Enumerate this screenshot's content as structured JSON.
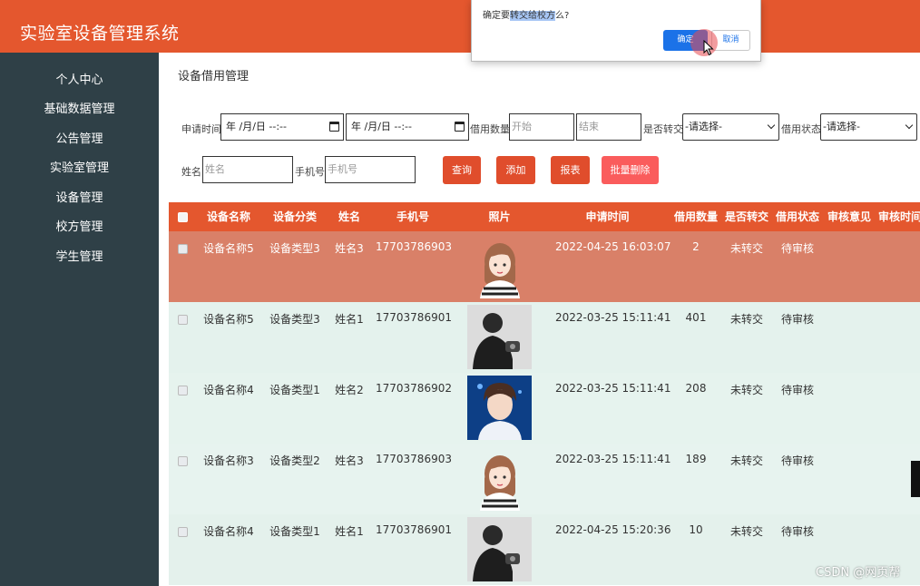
{
  "app": {
    "title": "实验室设备管理系统"
  },
  "sidebar": {
    "items": [
      {
        "label": "个人中心"
      },
      {
        "label": "基础数据管理"
      },
      {
        "label": "公告管理"
      },
      {
        "label": "实验室管理"
      },
      {
        "label": "设备管理"
      },
      {
        "label": "校方管理"
      },
      {
        "label": "学生管理"
      }
    ]
  },
  "page": {
    "title": "设备借用管理"
  },
  "search": {
    "apply_time_label": "申请时间",
    "date_start_value": "年 /月/日 --:--",
    "date_end_value": "年 /月/日 --:--",
    "quantity_label": "借用数量",
    "quantity_start_placeholder": "开始",
    "quantity_end_placeholder": "结束",
    "transfer_label": "是否转交",
    "transfer_selected": "-请选择-",
    "status_label": "借用状态",
    "status_selected": "-请选择-",
    "name_label": "姓名",
    "name_placeholder": "姓名",
    "phone_label": "手机号",
    "phone_placeholder": "手机号",
    "query_button": "查询",
    "add_button": "添加",
    "report_button": "报表",
    "batch_delete_button": "批量删除"
  },
  "table": {
    "columns": [
      "设备名称",
      "设备分类",
      "姓名",
      "手机号",
      "照片",
      "申请时间",
      "借用数量",
      "是否转交",
      "借用状态",
      "审核意见",
      "审核时间"
    ],
    "rows": [
      {
        "device": "设备名称5",
        "category": "设备类型3",
        "name": "姓名3",
        "phone": "17703786903",
        "photo": "cartoon-girl",
        "time": "2022-04-25 16:03:07",
        "qty": "2",
        "transfer": "未转交",
        "status": "待审核",
        "highlighted": true
      },
      {
        "device": "设备名称5",
        "category": "设备类型3",
        "name": "姓名1",
        "phone": "17703786901",
        "photo": "man-silhouette",
        "time": "2022-03-25 15:11:41",
        "qty": "401",
        "transfer": "未转交",
        "status": "待审核",
        "highlighted": false
      },
      {
        "device": "设备名称4",
        "category": "设备类型1",
        "name": "姓名2",
        "phone": "17703786902",
        "photo": "young-man",
        "time": "2022-03-25 15:11:41",
        "qty": "208",
        "transfer": "未转交",
        "status": "待审核",
        "highlighted": false
      },
      {
        "device": "设备名称3",
        "category": "设备类型2",
        "name": "姓名3",
        "phone": "17703786903",
        "photo": "cartoon-girl",
        "time": "2022-03-25 15:11:41",
        "qty": "189",
        "transfer": "未转交",
        "status": "待审核",
        "highlighted": false
      },
      {
        "device": "设备名称4",
        "category": "设备类型1",
        "name": "姓名1",
        "phone": "17703786901",
        "photo": "man-silhouette",
        "time": "2022-04-25 15:20:36",
        "qty": "10",
        "transfer": "未转交",
        "status": "待审核",
        "highlighted": false
      }
    ]
  },
  "dialog": {
    "message_prefix": "确定要",
    "message_selected": "转交给校方",
    "message_suffix": "么?",
    "ok_button": "确定",
    "cancel_button": "取消"
  },
  "watermark": "CSDN @网页帮",
  "colors": {
    "brand": "#e4572e",
    "sidebar": "#2f4047",
    "highlight_row": "#d98068",
    "row_bg": "#e6f3ee",
    "button_red": "#e04d2c",
    "button_pink": "#fa5c5c",
    "dialog_primary": "#1b72e8"
  }
}
